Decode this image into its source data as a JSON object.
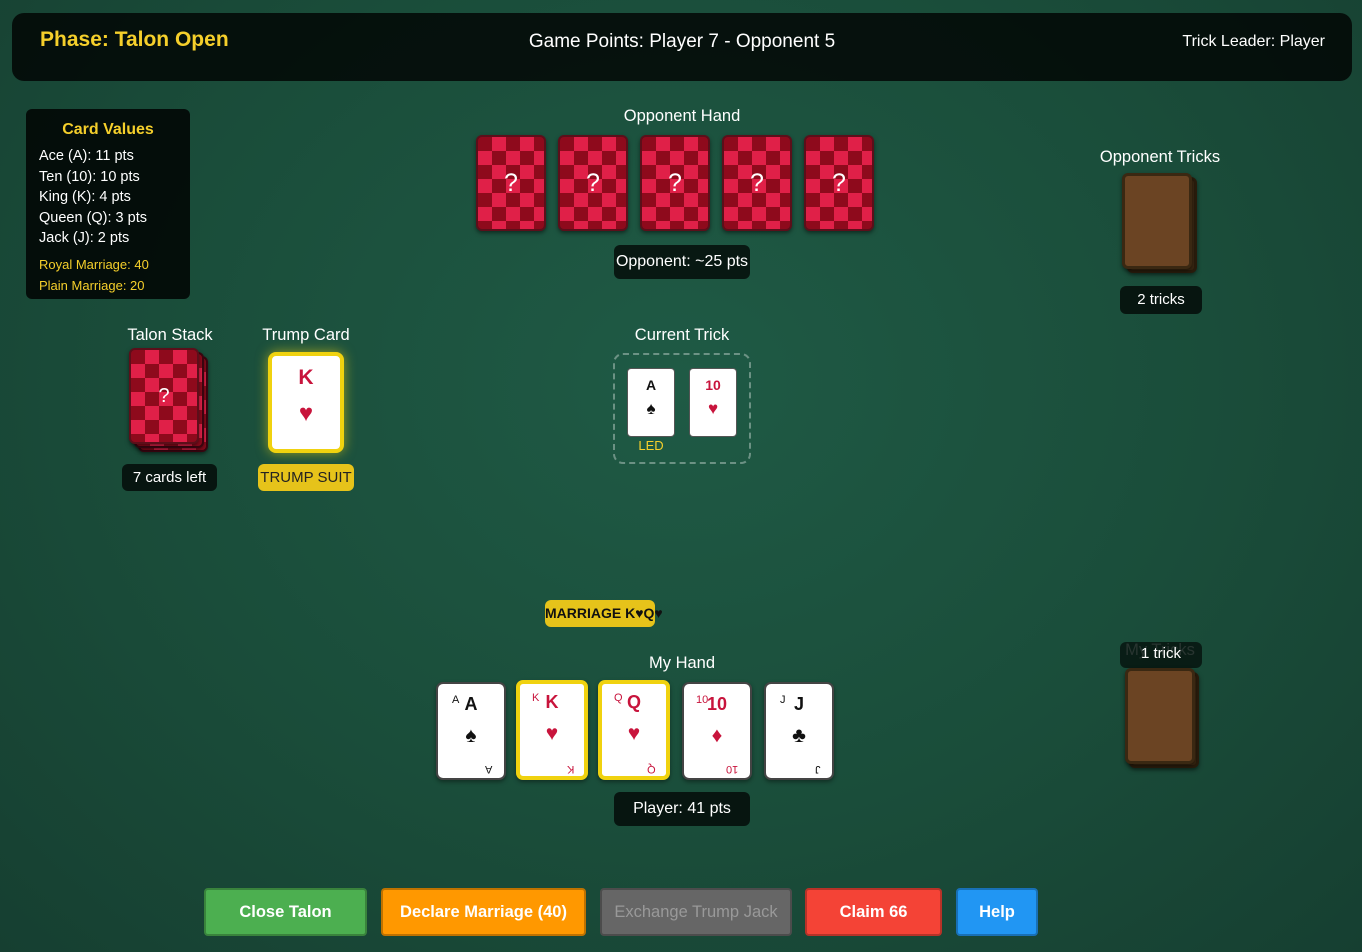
{
  "header": {
    "phase": "Phase: Talon Open",
    "game_points": "Game Points: Player 7 - Opponent 5",
    "trick_leader": "Trick Leader: Player"
  },
  "card_values": {
    "title": "Card Values",
    "lines": [
      "Ace (A): 11 pts",
      "Ten (10): 10 pts",
      "King (K): 4 pts",
      "Queen (Q): 3 pts",
      "Jack (J): 2 pts"
    ],
    "royal": "Royal Marriage: 40",
    "plain": "Plain Marriage: 20"
  },
  "opponent": {
    "label": "Opponent Hand",
    "card_back_text": "?",
    "card_count": 5,
    "score": "Opponent: ~25 pts",
    "tricks_label": "Opponent Tricks",
    "tricks_count": "2 tricks"
  },
  "talon": {
    "label": "Talon Stack",
    "back_text": "?",
    "count_text": "7 cards left"
  },
  "trump": {
    "label": "Trump Card",
    "rank": "K",
    "suit": "♥",
    "badge": "TRUMP SUIT"
  },
  "current_trick": {
    "label": "Current Trick",
    "cards": [
      {
        "rank": "A",
        "suit": "♠",
        "color": "black"
      },
      {
        "rank": "10",
        "suit": "♥",
        "color": "red"
      }
    ],
    "led_tag": "LED"
  },
  "marriage_badge": "MARRIAGE K♥Q♥",
  "player": {
    "label": "My Hand",
    "hand": [
      {
        "rank": "A",
        "suit": "♠",
        "color": "black",
        "selected": false
      },
      {
        "rank": "K",
        "suit": "♥",
        "color": "red",
        "selected": true
      },
      {
        "rank": "Q",
        "suit": "♥",
        "color": "red",
        "selected": true
      },
      {
        "rank": "10",
        "suit": "♦",
        "color": "red",
        "selected": false
      },
      {
        "rank": "J",
        "suit": "♣",
        "color": "black",
        "selected": false
      }
    ],
    "score": "Player: 41 pts",
    "tricks_label": "My Tricks",
    "tricks_count": "1 trick"
  },
  "buttons": {
    "close_talon": "Close Talon",
    "declare_marriage": "Declare Marriage (40)",
    "exchange_jack": "Exchange Trump Jack",
    "claim": "Claim 66",
    "help": "Help"
  },
  "colors": {
    "accent_gold": "#f5cf2b",
    "close_talon": "#4caf50",
    "declare_marriage": "#ff9800",
    "exchange_disabled": "#666666",
    "claim": "#f44336",
    "help": "#2196f3"
  }
}
